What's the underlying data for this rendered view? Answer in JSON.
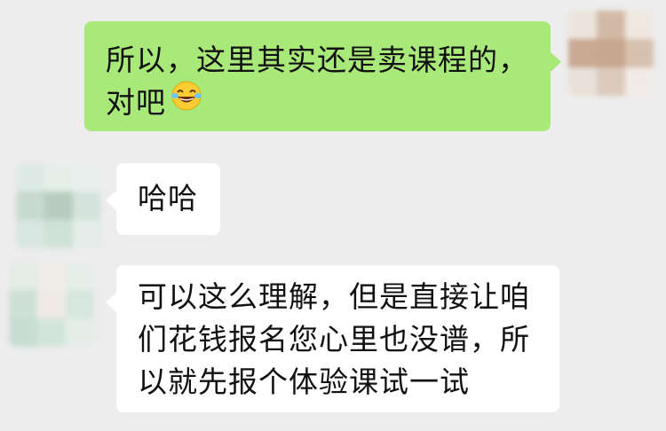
{
  "messages": [
    {
      "side": "right",
      "lines": [
        "所以，这里其实还是卖课程的，",
        "对吧"
      ],
      "emoji": "laughing-with-tears-emoji"
    },
    {
      "side": "left",
      "lines": [
        "哈哈"
      ]
    },
    {
      "side": "left",
      "lines": [
        "可以这么理解，但是直接让咱",
        "们花钱报名您心里也没谱，所",
        "以就先报个体验课试一试"
      ]
    }
  ],
  "colors": {
    "background": "#ededed",
    "self_bubble": "#a9e97a",
    "other_bubble": "#ffffff",
    "text": "#111111"
  },
  "avatars": {
    "self_palette": [
      "#ece4dc",
      "#d2b9a6",
      "#efe8e1",
      "#c9a992",
      "#c8a78f",
      "#d7c0ae",
      "#e9e1d9",
      "#dccabd",
      "#f0ebe6"
    ],
    "friend_palette": [
      "#dde9e4",
      "#e6eeea",
      "#e8efec",
      "#c7d9d0",
      "#b9cdbf",
      "#d5e3dd",
      "#d8e6e1",
      "#cfe1d8",
      "#e3ece8"
    ]
  }
}
